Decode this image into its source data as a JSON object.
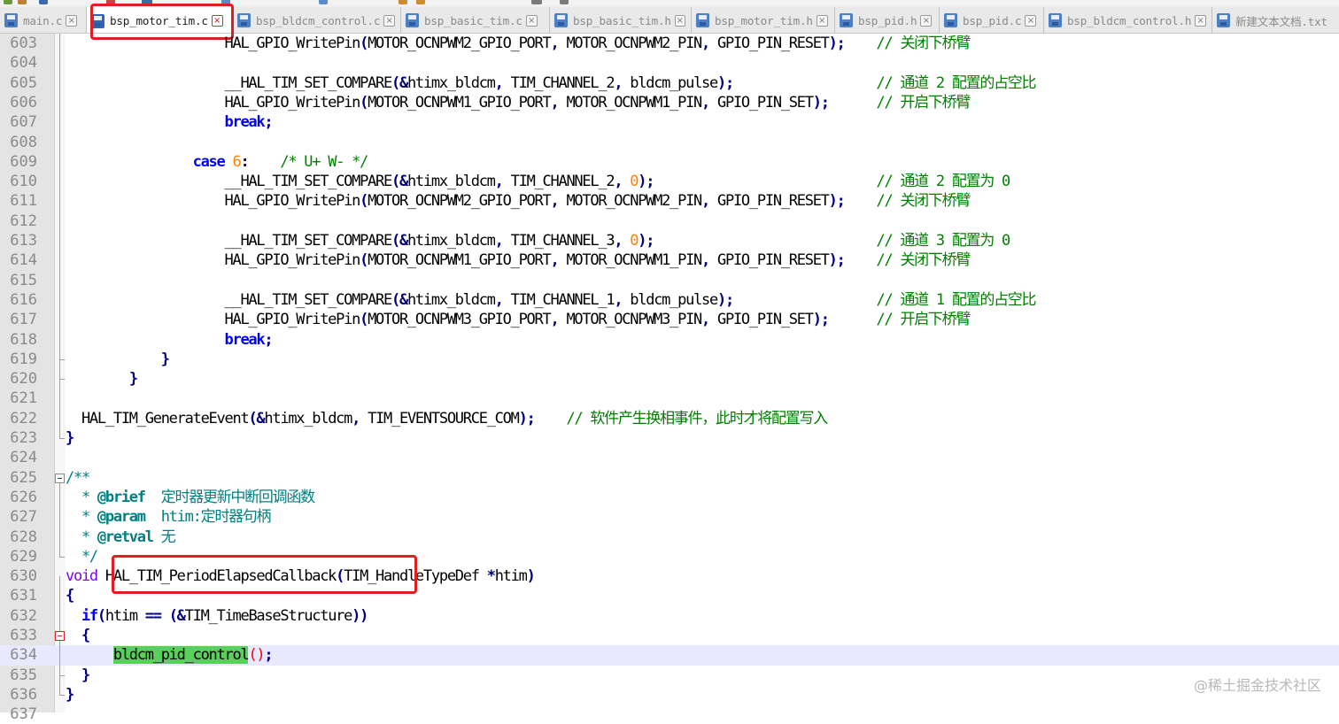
{
  "tabs": [
    {
      "label": "main.c",
      "active": false
    },
    {
      "label": "bsp_motor_tim.c",
      "active": true
    },
    {
      "label": "bsp_bldcm_control.c",
      "active": false
    },
    {
      "label": "bsp_basic_tim.c",
      "active": false
    },
    {
      "label": "bsp_basic_tim.h",
      "active": false
    },
    {
      "label": "bsp_motor_tim.h",
      "active": false
    },
    {
      "label": "bsp_pid.h",
      "active": false
    },
    {
      "label": "bsp_pid.c",
      "active": false
    },
    {
      "label": "bsp_bldcm_control.h",
      "active": false
    },
    {
      "label": "新建文本文档.txt",
      "active": false
    }
  ],
  "editor": {
    "current_line": 634,
    "lines": [
      {
        "n": "603",
        "t": [
          [
            "                    ",
            ""
          ],
          [
            "HAL_GPIO_WritePin",
            ""
          ],
          [
            "(",
            "op"
          ],
          [
            "MOTOR_OCNPWM2_GPIO_PORT",
            ""
          ],
          [
            ",",
            "op"
          ],
          [
            " MOTOR_OCNPWM2_PIN",
            ""
          ],
          [
            ",",
            "op"
          ],
          [
            " GPIO_PIN_RESET",
            ""
          ],
          [
            ");",
            "op"
          ],
          [
            "    ",
            ""
          ],
          [
            "// 关闭下桥臂",
            "cm"
          ]
        ]
      },
      {
        "n": "604",
        "t": []
      },
      {
        "n": "605",
        "t": [
          [
            "                    ",
            ""
          ],
          [
            "__HAL_TIM_SET_COMPARE",
            ""
          ],
          [
            "(&",
            "op"
          ],
          [
            "htimx_bldcm",
            ""
          ],
          [
            ",",
            "op"
          ],
          [
            " TIM_CHANNEL_2",
            ""
          ],
          [
            ",",
            "op"
          ],
          [
            " bldcm_pulse",
            ""
          ],
          [
            ");",
            "op"
          ],
          [
            "                  ",
            ""
          ],
          [
            "// 通道 2 配置的占空比",
            "cm"
          ]
        ]
      },
      {
        "n": "606",
        "t": [
          [
            "                    ",
            ""
          ],
          [
            "HAL_GPIO_WritePin",
            ""
          ],
          [
            "(",
            "op"
          ],
          [
            "MOTOR_OCNPWM1_GPIO_PORT",
            ""
          ],
          [
            ",",
            "op"
          ],
          [
            " MOTOR_OCNPWM1_PIN",
            ""
          ],
          [
            ",",
            "op"
          ],
          [
            " GPIO_PIN_SET",
            ""
          ],
          [
            ");",
            "op"
          ],
          [
            "      ",
            ""
          ],
          [
            "// 开启下桥臂",
            "cm"
          ]
        ]
      },
      {
        "n": "607",
        "t": [
          [
            "                    ",
            ""
          ],
          [
            "break",
            "kw"
          ],
          [
            ";",
            "op"
          ]
        ]
      },
      {
        "n": "608",
        "t": []
      },
      {
        "n": "609",
        "t": [
          [
            "                ",
            ""
          ],
          [
            "case",
            "kw"
          ],
          [
            " ",
            ""
          ],
          [
            "6",
            "num"
          ],
          [
            ":",
            "op"
          ],
          [
            "    ",
            ""
          ],
          [
            "/* U+ W- */",
            "cm"
          ]
        ]
      },
      {
        "n": "610",
        "t": [
          [
            "                    ",
            ""
          ],
          [
            "__HAL_TIM_SET_COMPARE",
            ""
          ],
          [
            "(&",
            "op"
          ],
          [
            "htimx_bldcm",
            ""
          ],
          [
            ",",
            "op"
          ],
          [
            " TIM_CHANNEL_2",
            ""
          ],
          [
            ",",
            "op"
          ],
          [
            " ",
            ""
          ],
          [
            "0",
            "num"
          ],
          [
            ");",
            "op"
          ],
          [
            "                            ",
            ""
          ],
          [
            "// 通道 2 配置为 0",
            "cm"
          ]
        ]
      },
      {
        "n": "611",
        "t": [
          [
            "                    ",
            ""
          ],
          [
            "HAL_GPIO_WritePin",
            ""
          ],
          [
            "(",
            "op"
          ],
          [
            "MOTOR_OCNPWM2_GPIO_PORT",
            ""
          ],
          [
            ",",
            "op"
          ],
          [
            " MOTOR_OCNPWM2_PIN",
            ""
          ],
          [
            ",",
            "op"
          ],
          [
            " GPIO_PIN_RESET",
            ""
          ],
          [
            ");",
            "op"
          ],
          [
            "    ",
            ""
          ],
          [
            "// 关闭下桥臂",
            "cm"
          ]
        ]
      },
      {
        "n": "612",
        "t": []
      },
      {
        "n": "613",
        "t": [
          [
            "                    ",
            ""
          ],
          [
            "__HAL_TIM_SET_COMPARE",
            ""
          ],
          [
            "(&",
            "op"
          ],
          [
            "htimx_bldcm",
            ""
          ],
          [
            ",",
            "op"
          ],
          [
            " TIM_CHANNEL_3",
            ""
          ],
          [
            ",",
            "op"
          ],
          [
            " ",
            ""
          ],
          [
            "0",
            "num"
          ],
          [
            ");",
            "op"
          ],
          [
            "                            ",
            ""
          ],
          [
            "// 通道 3 配置为 0",
            "cm"
          ]
        ]
      },
      {
        "n": "614",
        "t": [
          [
            "                    ",
            ""
          ],
          [
            "HAL_GPIO_WritePin",
            ""
          ],
          [
            "(",
            "op"
          ],
          [
            "MOTOR_OCNPWM1_GPIO_PORT",
            ""
          ],
          [
            ",",
            "op"
          ],
          [
            " MOTOR_OCNPWM1_PIN",
            ""
          ],
          [
            ",",
            "op"
          ],
          [
            " GPIO_PIN_RESET",
            ""
          ],
          [
            ");",
            "op"
          ],
          [
            "    ",
            ""
          ],
          [
            "// 关闭下桥臂",
            "cm"
          ]
        ]
      },
      {
        "n": "615",
        "t": []
      },
      {
        "n": "616",
        "t": [
          [
            "                    ",
            ""
          ],
          [
            "__HAL_TIM_SET_COMPARE",
            ""
          ],
          [
            "(&",
            "op"
          ],
          [
            "htimx_bldcm",
            ""
          ],
          [
            ",",
            "op"
          ],
          [
            " TIM_CHANNEL_1",
            ""
          ],
          [
            ",",
            "op"
          ],
          [
            " bldcm_pulse",
            ""
          ],
          [
            ");",
            "op"
          ],
          [
            "                  ",
            ""
          ],
          [
            "// 通道 1 配置的占空比",
            "cm"
          ]
        ]
      },
      {
        "n": "617",
        "t": [
          [
            "                    ",
            ""
          ],
          [
            "HAL_GPIO_WritePin",
            ""
          ],
          [
            "(",
            "op"
          ],
          [
            "MOTOR_OCNPWM3_GPIO_PORT",
            ""
          ],
          [
            ",",
            "op"
          ],
          [
            " MOTOR_OCNPWM3_PIN",
            ""
          ],
          [
            ",",
            "op"
          ],
          [
            " GPIO_PIN_SET",
            ""
          ],
          [
            ");",
            "op"
          ],
          [
            "      ",
            ""
          ],
          [
            "// 开启下桥臂",
            "cm"
          ]
        ]
      },
      {
        "n": "618",
        "t": [
          [
            "                    ",
            ""
          ],
          [
            "break",
            "kw"
          ],
          [
            ";",
            "op"
          ]
        ]
      },
      {
        "n": "619",
        "t": [
          [
            "            ",
            ""
          ],
          [
            "}",
            "op"
          ]
        ]
      },
      {
        "n": "620",
        "t": [
          [
            "        ",
            ""
          ],
          [
            "}",
            "op"
          ]
        ]
      },
      {
        "n": "621",
        "t": []
      },
      {
        "n": "622",
        "t": [
          [
            "  ",
            ""
          ],
          [
            "HAL_TIM_GenerateEvent",
            ""
          ],
          [
            "(&",
            "op"
          ],
          [
            "htimx_bldcm",
            ""
          ],
          [
            ",",
            "op"
          ],
          [
            " TIM_EVENTSOURCE_COM",
            ""
          ],
          [
            ");",
            "op"
          ],
          [
            "    ",
            ""
          ],
          [
            "// 软件产生换相事件，此时才将配置写入",
            "cm"
          ]
        ]
      },
      {
        "n": "623",
        "t": [
          [
            "}",
            "op"
          ]
        ]
      },
      {
        "n": "624",
        "t": []
      },
      {
        "n": "625",
        "t": [
          [
            "/**",
            "doc"
          ]
        ]
      },
      {
        "n": "626",
        "t": [
          [
            "  * ",
            "doc"
          ],
          [
            "@brief",
            "tag"
          ],
          [
            "  定时器更新中断回调函数",
            "doc"
          ]
        ]
      },
      {
        "n": "627",
        "t": [
          [
            "  * ",
            "doc"
          ],
          [
            "@param",
            "tag"
          ],
          [
            "  htim:定时器句柄",
            "doc"
          ]
        ]
      },
      {
        "n": "628",
        "t": [
          [
            "  * ",
            "doc"
          ],
          [
            "@retval",
            "tag"
          ],
          [
            " 无",
            "doc"
          ]
        ]
      },
      {
        "n": "629",
        "t": [
          [
            "  */",
            "doc"
          ]
        ]
      },
      {
        "n": "630",
        "t": [
          [
            "void",
            "ty"
          ],
          [
            " HAL_TIM_PeriodElapsedCallback",
            ""
          ],
          [
            "(",
            "op"
          ],
          [
            "TIM_HandleTypeDef ",
            ""
          ],
          [
            "*",
            "op"
          ],
          [
            "htim",
            ""
          ],
          [
            ")",
            "op"
          ]
        ]
      },
      {
        "n": "631",
        "t": [
          [
            "{",
            "op"
          ]
        ]
      },
      {
        "n": "632",
        "t": [
          [
            "  ",
            ""
          ],
          [
            "if",
            "kw"
          ],
          [
            "(",
            "op"
          ],
          [
            "htim ",
            ""
          ],
          [
            "==",
            "op"
          ],
          [
            " ",
            ""
          ],
          [
            "(&",
            "op"
          ],
          [
            "TIM_TimeBaseStructure",
            ""
          ],
          [
            "))",
            "op"
          ]
        ]
      },
      {
        "n": "633",
        "t": [
          [
            "  ",
            ""
          ],
          [
            "{",
            "op"
          ]
        ]
      },
      {
        "n": "634",
        "t": [
          [
            "      ",
            ""
          ],
          [
            "bldcm_pid_control",
            "hl"
          ],
          [
            "()",
            "red"
          ],
          [
            ";",
            "op"
          ]
        ]
      },
      {
        "n": "635",
        "t": [
          [
            "  ",
            ""
          ],
          [
            "}",
            "op"
          ]
        ]
      },
      {
        "n": "636",
        "t": [
          [
            "}",
            "op"
          ]
        ]
      },
      {
        "n": "637",
        "t": []
      }
    ]
  },
  "watermark": "@稀土掘金技术社区"
}
